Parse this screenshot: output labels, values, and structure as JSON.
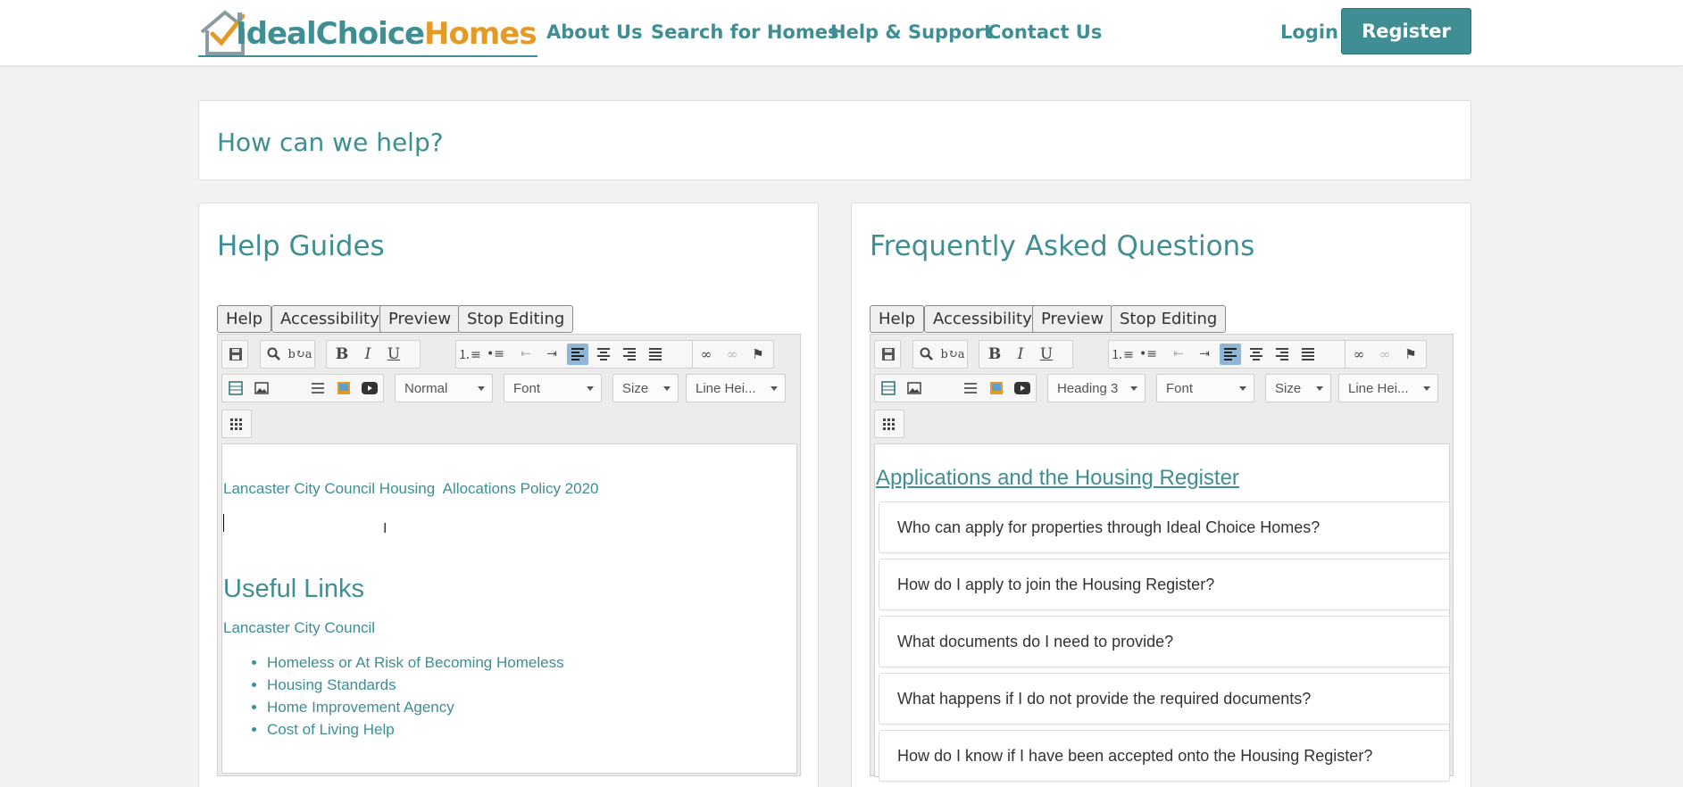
{
  "nav": {
    "logo": {
      "part1": "IdealChoice",
      "part2": "Homes"
    },
    "links": [
      "About Us",
      "Search for Homes",
      "Help & Support",
      "Contact Us"
    ],
    "login": "Login",
    "register": "Register"
  },
  "help_heading": "How can we help?",
  "editor": {
    "buttons": [
      "Help",
      "Accessibility",
      "Preview",
      "Stop Editing"
    ],
    "font_combo": "Font",
    "size_combo": "Size",
    "line_height_combo": "Line Hei..."
  },
  "guides": {
    "title": "Help Guides",
    "format_combo": "Normal",
    "policy_link": "Lancaster City Council Housing  Allocations Policy 2020",
    "useful_links_heading": "Useful Links",
    "council_link": "Lancaster City Council",
    "links": [
      "Homeless or At Risk of Becoming Homeless",
      "Housing Standards",
      "Home Improvement Agency",
      "Cost of Living Help"
    ]
  },
  "faq": {
    "title": "Frequently Asked Questions",
    "format_combo": "Heading 3",
    "section_heading": "Applications and the Housing Register",
    "questions": [
      "Who can apply for properties through Ideal Choice Homes?",
      "How do I apply to join the Housing Register?",
      "What documents do I need to provide?",
      "What happens if I do not provide the required documents?",
      "How do I know if I have been accepted onto the Housing Register?"
    ]
  },
  "colors": {
    "brand_teal": "#3e8e93",
    "brand_orange": "#e49a27",
    "active_tool": "#8fb6d6"
  }
}
